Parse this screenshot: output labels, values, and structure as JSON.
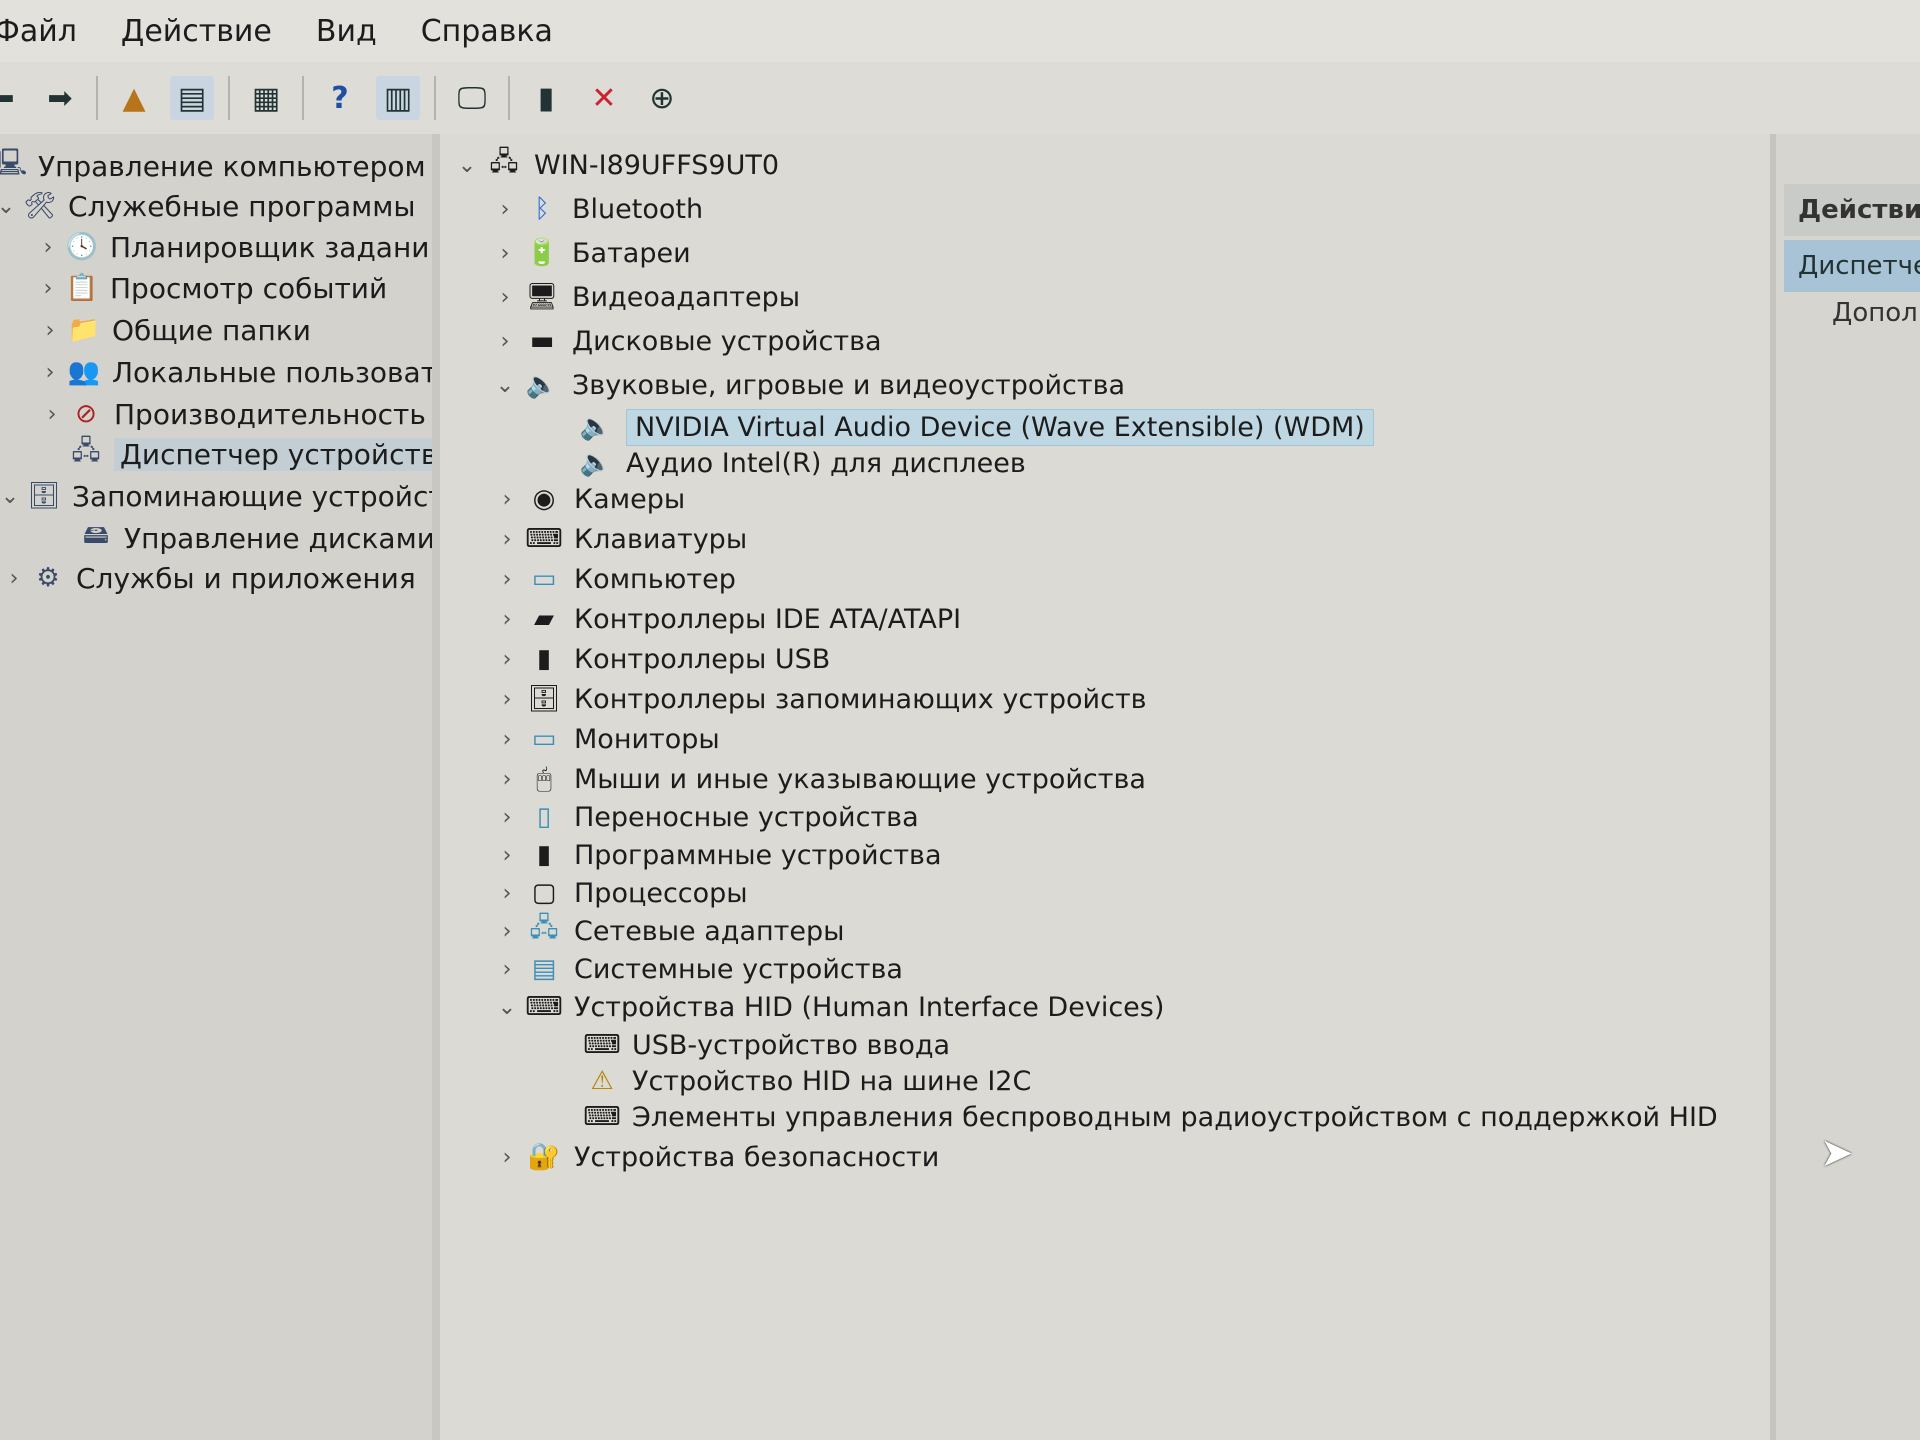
{
  "menu": [
    "Файл",
    "Действие",
    "Вид",
    "Справка"
  ],
  "toolbar": {
    "buttons": [
      "back-icon",
      "forward-icon",
      "up-folder-icon",
      "show-hide-tree-icon",
      "properties-icon",
      "help-icon",
      "show-action-pane-icon",
      "scan-hardware-icon",
      "update-driver-icon",
      "uninstall-icon",
      "download-icon"
    ]
  },
  "left_tree": {
    "root": "Управление компьютером (л",
    "system_tools": "Служебные программы",
    "task_scheduler": "Планировщик заданий",
    "event_viewer": "Просмотр событий",
    "shared_folders": "Общие папки",
    "local_users": "Локальные пользовате",
    "performance": "Производительность",
    "device_manager": "Диспетчер устройств",
    "storage": "Запоминающие устройст",
    "disk_management": "Управление дисками",
    "services": "Службы и приложения"
  },
  "device_tree": {
    "computer_name": "WIN-I89UFFS9UT0",
    "categories": {
      "bluetooth": "Bluetooth",
      "batteries": "Батареи",
      "video_adapters": "Видеоадаптеры",
      "disk_drives": "Дисковые устройства",
      "sound": "Звуковые, игровые и видеоустройства",
      "sound_child_1": "NVIDIA Virtual Audio Device (Wave Extensible) (WDM)",
      "sound_child_2": "Аудио Intel(R) для дисплеев",
      "cameras": "Камеры",
      "keyboards": "Клавиатуры",
      "computer": "Компьютер",
      "ide": "Контроллеры IDE ATA/ATAPI",
      "usb": "Контроллеры USB",
      "storage_ctrl": "Контроллеры запоминающих устройств",
      "monitors": "Мониторы",
      "mice": "Мыши и иные указывающие устройства",
      "portable": "Переносные устройства",
      "software": "Программные устройства",
      "processors": "Процессоры",
      "network": "Сетевые адаптеры",
      "system": "Системные устройства",
      "hid": "Устройства HID (Human Interface Devices)",
      "hid_child_1": "USB-устройство ввода",
      "hid_child_2": "Устройство HID на шине I2C",
      "hid_child_3": "Элементы управления беспроводным радиоустройством с поддержкой HID",
      "security": "Устройства безопасности"
    }
  },
  "actions": {
    "title": "Действия",
    "selected": "Диспетчер",
    "more": "Дополн"
  },
  "colors": {
    "selection": "#bfd7e2",
    "actions_selected": "#a9c3d6"
  }
}
